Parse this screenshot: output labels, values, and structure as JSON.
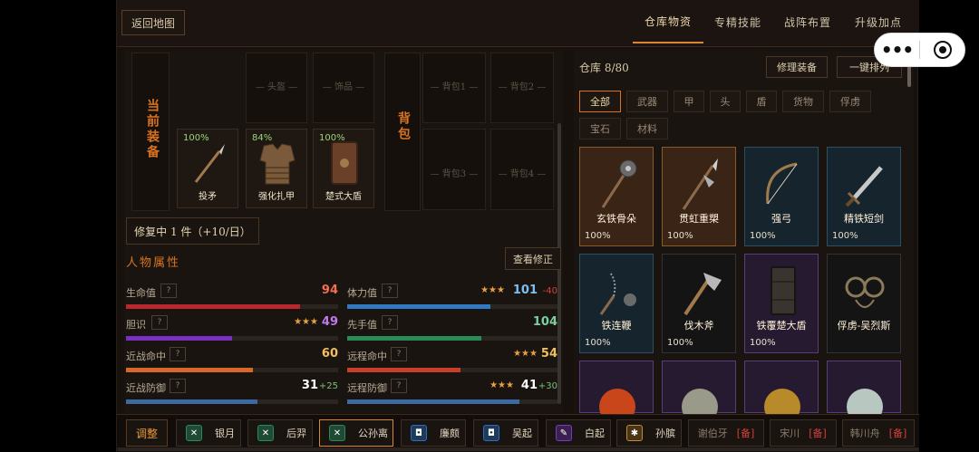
{
  "header": {
    "back_label": "返回地图",
    "tabs": [
      {
        "label": "仓库物资",
        "active": true
      },
      {
        "label": "专精技能",
        "active": false
      },
      {
        "label": "战阵布置",
        "active": false
      },
      {
        "label": "升级加点",
        "active": false
      }
    ]
  },
  "capsule": {
    "more_icon": "more-dots-icon",
    "close_icon": "record-icon"
  },
  "equipment": {
    "current_label": "当前装备",
    "bag_label": "背包",
    "slots_top": [
      "— 头盔 —",
      "— 饰品 —"
    ],
    "bag_slots": [
      "— 背包1 —",
      "— 背包2 —",
      "— 背包3 —",
      "— 背包4 —"
    ],
    "items": [
      {
        "name": "投矛",
        "pct": "100%",
        "icon": "spear-icon"
      },
      {
        "name": "强化扎甲",
        "pct": "84%",
        "icon": "armor-icon"
      },
      {
        "name": "楚式大盾",
        "pct": "100%",
        "icon": "shield-icon"
      }
    ],
    "repair_label": "修复中 1 件（+10/日）"
  },
  "attributes": {
    "title": "人物属性",
    "view_mod_label": "查看修正",
    "left": [
      {
        "label": "生命值",
        "value": "94",
        "stars": "",
        "bonus": "",
        "color": "#b8282e",
        "val_color": "#f07050",
        "fill": 0.82
      },
      {
        "label": "胆识",
        "value": "49",
        "stars": "★★★",
        "bonus": "",
        "color": "#7a2fc0",
        "val_color": "#c07af0",
        "fill": 0.48
      },
      {
        "label": "近战命中",
        "value": "60",
        "stars": "",
        "bonus": "",
        "color": "#d8682a",
        "val_color": "#f0c060",
        "fill": 0.6
      },
      {
        "label": "近战防御",
        "value": "31",
        "stars": "",
        "bonus": "+25",
        "color": "#3c6aa0",
        "val_color": "#ffffff",
        "fill": 0.62
      }
    ],
    "right": [
      {
        "label": "体力值",
        "value": "101",
        "stars": "★★★",
        "bonus": "-40",
        "color": "#2f7ac0",
        "val_color": "#7ac0f0",
        "fill": 0.68
      },
      {
        "label": "先手值",
        "value": "104",
        "stars": "",
        "bonus": "",
        "color": "#2a8a5a",
        "val_color": "#7ad0a0",
        "fill": 0.64
      },
      {
        "label": "远程命中",
        "value": "54",
        "stars": "★★★",
        "bonus": "",
        "color": "#c8402a",
        "val_color": "#f0c060",
        "fill": 0.54
      },
      {
        "label": "远程防御",
        "value": "41",
        "stars": "★★★",
        "bonus": "+30",
        "color": "#3c6aa0",
        "val_color": "#ffffff",
        "fill": 0.82
      }
    ]
  },
  "warehouse": {
    "capacity": "仓库 8/80",
    "repair_all_label": "修理装备",
    "sort_label": "一键排列",
    "filters": [
      "全部",
      "武器",
      "甲",
      "头",
      "盾",
      "货物",
      "俘虏",
      "宝石",
      "材料"
    ],
    "items": [
      {
        "name": "玄铁骨朵",
        "pct": "100%",
        "icon": "mace-icon",
        "bg": "#3a2416",
        "border": "#8a5a2a"
      },
      {
        "name": "贯虹重槊",
        "pct": "100%",
        "icon": "halberd-icon",
        "bg": "#3a2416",
        "border": "#8a5a2a"
      },
      {
        "name": "强弓",
        "pct": "100%",
        "icon": "bow-icon",
        "bg": "#16242e",
        "border": "#2e4e62"
      },
      {
        "name": "精铁短剑",
        "pct": "100%",
        "icon": "sword-icon",
        "bg": "#16242e",
        "border": "#2e4e62"
      },
      {
        "name": "铁连鞭",
        "pct": "100%",
        "icon": "flail-icon",
        "bg": "#16242e",
        "border": "#2e4e62"
      },
      {
        "name": "伐木斧",
        "pct": "100%",
        "icon": "axe-icon",
        "bg": "#141414",
        "border": "#333333"
      },
      {
        "name": "铁覆楚大盾",
        "pct": "100%",
        "icon": "tower-shield-icon",
        "bg": "#261a30",
        "border": "#5a3c7a"
      },
      {
        "name": "俘虏-吴烈斯",
        "pct": "",
        "icon": "shackles-icon",
        "bg": "#141414",
        "border": "#333333"
      },
      {
        "name": "",
        "pct": "",
        "icon": "gem-red-icon",
        "bg": "#261a30",
        "border": "#5a3c7a"
      },
      {
        "name": "",
        "pct": "",
        "icon": "gem-silver-icon",
        "bg": "#261a30",
        "border": "#5a3c7a"
      },
      {
        "name": "",
        "pct": "",
        "icon": "gem-gold-icon",
        "bg": "#261a30",
        "border": "#5a3c7a"
      },
      {
        "name": "",
        "pct": "",
        "icon": "gem-pearl-icon",
        "bg": "#261a30",
        "border": "#5a3c7a"
      }
    ]
  },
  "squad": {
    "adjust_label": "调整",
    "heroes": [
      {
        "name": "银月",
        "icon": "sword-cross-icon",
        "color": "#2a8a5a",
        "active": false,
        "tag": ""
      },
      {
        "name": "后羿",
        "icon": "sword-cross-icon",
        "color": "#2a8a5a",
        "active": false,
        "tag": ""
      },
      {
        "name": "公孙离",
        "icon": "sword-cross-icon",
        "color": "#2a8a5a",
        "active": true,
        "tag": ""
      },
      {
        "name": "廉颇",
        "icon": "shield-small-icon",
        "color": "#2f6ac0",
        "active": false,
        "tag": ""
      },
      {
        "name": "吴起",
        "icon": "shield-small-icon",
        "color": "#2f6ac0",
        "active": false,
        "tag": ""
      },
      {
        "name": "白起",
        "icon": "pen-icon",
        "color": "#7a3ac0",
        "active": false,
        "tag": ""
      },
      {
        "name": "孙膑",
        "icon": "star-x-icon",
        "color": "#c08a2a",
        "active": false,
        "tag": ""
      },
      {
        "name": "谢伯牙",
        "icon": "",
        "color": "",
        "active": false,
        "tag": "[备]"
      },
      {
        "name": "宋川",
        "icon": "",
        "color": "",
        "active": false,
        "tag": "[备]"
      },
      {
        "name": "韩川舟",
        "icon": "",
        "color": "",
        "active": false,
        "tag": "[备]"
      }
    ]
  }
}
